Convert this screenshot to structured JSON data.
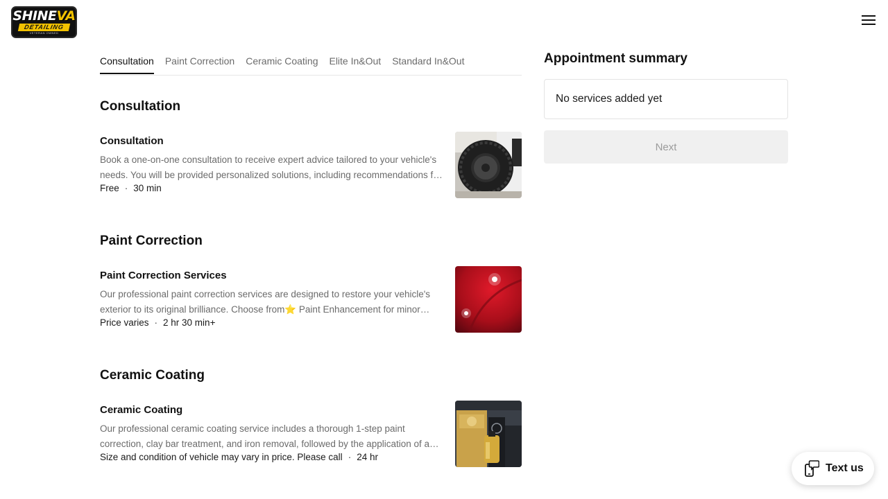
{
  "brand": {
    "logo_main": "SHINE",
    "logo_accent": "VA",
    "logo_sub": "DETAILING",
    "logo_tag": "VETERAN OWNED"
  },
  "header": {
    "menu_icon": "hamburger-menu-icon"
  },
  "tabs": [
    {
      "label": "Consultation",
      "active": true
    },
    {
      "label": "Paint Correction",
      "active": false
    },
    {
      "label": "Ceramic Coating",
      "active": false
    },
    {
      "label": "Elite In&Out",
      "active": false
    },
    {
      "label": "Standard In&Out",
      "active": false
    }
  ],
  "sections": [
    {
      "title": "Consultation",
      "service": {
        "name": "Consultation",
        "description": "Book a one-on-one consultation to receive expert advice tailored to your vehicle's needs. You will be provided personalized solutions, including recommendations for the right detailing services.",
        "price": "Free",
        "duration": "30 min"
      }
    },
    {
      "title": "Paint Correction",
      "service": {
        "name": "Paint Correction Services",
        "description": "Our professional paint correction services are designed to restore your vehicle's exterior to its original brilliance. Choose from⭐ Paint Enhancement for minor imperfections or a multi-step correction.",
        "price": "Price varies",
        "duration": "2 hr 30 min+"
      }
    },
    {
      "title": "Ceramic Coating",
      "service": {
        "name": "Ceramic Coating",
        "description": "Our professional ceramic coating service includes a thorough 1-step paint correction, clay bar treatment, and iron removal, followed by the application of a long-lasting ceramic coating.",
        "price": "Size and condition of vehicle may vary in price. Please call",
        "duration": "24 hr"
      }
    }
  ],
  "summary": {
    "title": "Appointment summary",
    "empty_text": "No services added yet",
    "next_label": "Next"
  },
  "chat": {
    "label": "Text us",
    "icon": "phone-chat-icon"
  },
  "colors": {
    "accent": "#111111",
    "brand_yellow": "#f2c200",
    "muted": "#6b6b6b",
    "disabled_bg": "#f0f0f0"
  }
}
